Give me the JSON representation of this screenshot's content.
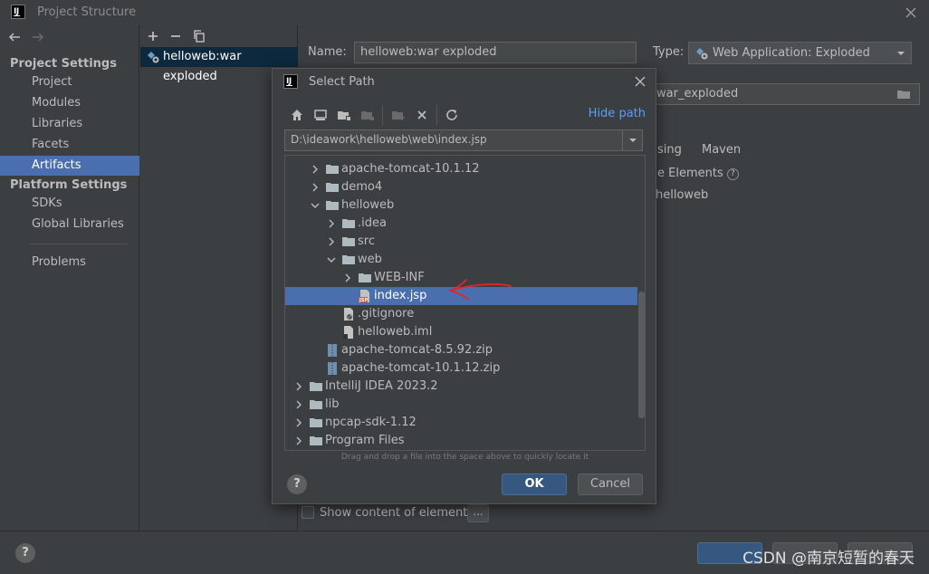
{
  "window": {
    "title": "Project Structure"
  },
  "left": {
    "project_settings_header": "Project Settings",
    "project_items": [
      "Project",
      "Modules",
      "Libraries",
      "Facets",
      "Artifacts"
    ],
    "platform_settings_header": "Platform Settings",
    "platform_items": [
      "SDKs",
      "Global Libraries"
    ],
    "problems": "Problems",
    "selected": "Artifacts"
  },
  "artifacts": {
    "item": "helloweb:war exploded"
  },
  "editor": {
    "name_label": "Name:",
    "name_value": "helloweb:war exploded",
    "type_label": "Type:",
    "type_value": "Web Application: Exploded",
    "output_fragment": "war_exploded",
    "tab_fragment": "sing",
    "maven_tab": "Maven",
    "elements_fragment": "e Elements",
    "tree_fragment": "helloweb",
    "show_content": "Show content of elements",
    "dots_button": "..."
  },
  "dialog": {
    "title": "Select Path",
    "hide_path": "Hide path",
    "path": "D:\\ideawork\\helloweb\\web\\index.jsp",
    "tree": [
      {
        "label": "apache-tomcat-10.1.12",
        "type": "folder",
        "depth": 0,
        "expanded": false
      },
      {
        "label": "demo4",
        "type": "folder",
        "depth": 0,
        "expanded": false
      },
      {
        "label": "helloweb",
        "type": "folder",
        "depth": 0,
        "expanded": true
      },
      {
        "label": ".idea",
        "type": "folder",
        "depth": 1,
        "expanded": false
      },
      {
        "label": "src",
        "type": "folder",
        "depth": 1,
        "expanded": false
      },
      {
        "label": "web",
        "type": "folder",
        "depth": 1,
        "expanded": true
      },
      {
        "label": "WEB-INF",
        "type": "folder",
        "depth": 2,
        "expanded": false
      },
      {
        "label": "index.jsp",
        "type": "jsp",
        "depth": 2,
        "selected": true
      },
      {
        "label": ".gitignore",
        "type": "gitignore",
        "depth": 1
      },
      {
        "label": "helloweb.iml",
        "type": "iml",
        "depth": 1
      },
      {
        "label": "apache-tomcat-8.5.92.zip",
        "type": "zip",
        "depth": 0
      },
      {
        "label": "apache-tomcat-10.1.12.zip",
        "type": "zip",
        "depth": 0
      },
      {
        "label": "IntelliJ IDEA 2023.2",
        "type": "folder",
        "depth": -1,
        "expanded": false
      },
      {
        "label": "lib",
        "type": "folder",
        "depth": -1,
        "expanded": false
      },
      {
        "label": "npcap-sdk-1.12",
        "type": "folder",
        "depth": -1,
        "expanded": false
      },
      {
        "label": "Program Files",
        "type": "folder",
        "depth": -1,
        "expanded": false
      }
    ],
    "drag_hint": "Drag and drop a file into the space above to quickly locate it",
    "ok": "OK",
    "cancel": "Cancel"
  },
  "bottom": {
    "help": "?"
  },
  "watermark": "CSDN @南京短暂的春天",
  "colors": {
    "selection": "#4b6eaf",
    "link": "#589df6",
    "annotation": "#e0252b",
    "primary_button": "#365880"
  }
}
